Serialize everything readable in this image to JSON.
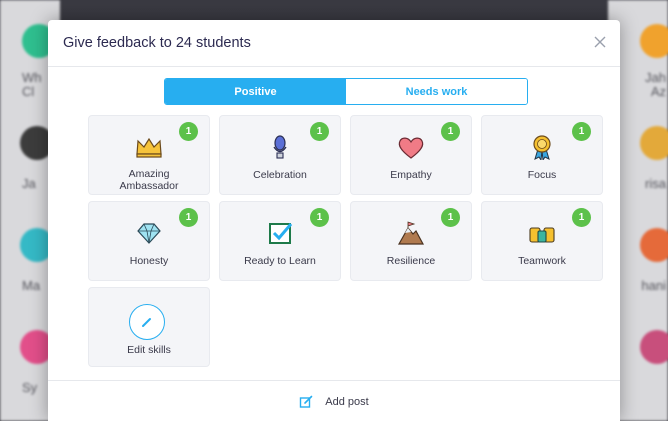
{
  "colors": {
    "accent": "#27aef0",
    "badge": "#5cc14a",
    "tile_bg": "#f4f5f8"
  },
  "background": {
    "left_names": [
      "Wh",
      "Cl",
      "Ja",
      "Ma",
      "Sy"
    ],
    "right_names": [
      "Jah",
      "Az",
      "risa",
      "hani"
    ]
  },
  "modal": {
    "title": "Give feedback to 24 students",
    "close_icon": "close-icon",
    "tabs": [
      {
        "label": "Positive",
        "active": true
      },
      {
        "label": "Needs work",
        "active": false
      }
    ],
    "skills": [
      {
        "label": "Amazing Ambassador",
        "badge": "1",
        "icon": "crown-icon"
      },
      {
        "label": "Celebration",
        "badge": "1",
        "icon": "microphone-icon"
      },
      {
        "label": "Empathy",
        "badge": "1",
        "icon": "heart-icon"
      },
      {
        "label": "Focus",
        "badge": "1",
        "icon": "medal-icon"
      },
      {
        "label": "Honesty",
        "badge": "1",
        "icon": "diamond-icon"
      },
      {
        "label": "Ready to Learn",
        "badge": "1",
        "icon": "checkbox-icon"
      },
      {
        "label": "Resilience",
        "badge": "1",
        "icon": "mountain-flag-icon"
      },
      {
        "label": "Teamwork",
        "badge": "1",
        "icon": "team-icon"
      }
    ],
    "edit_skills_label": "Edit skills",
    "footer": {
      "label": "Add post",
      "icon": "edit-post-icon"
    }
  }
}
